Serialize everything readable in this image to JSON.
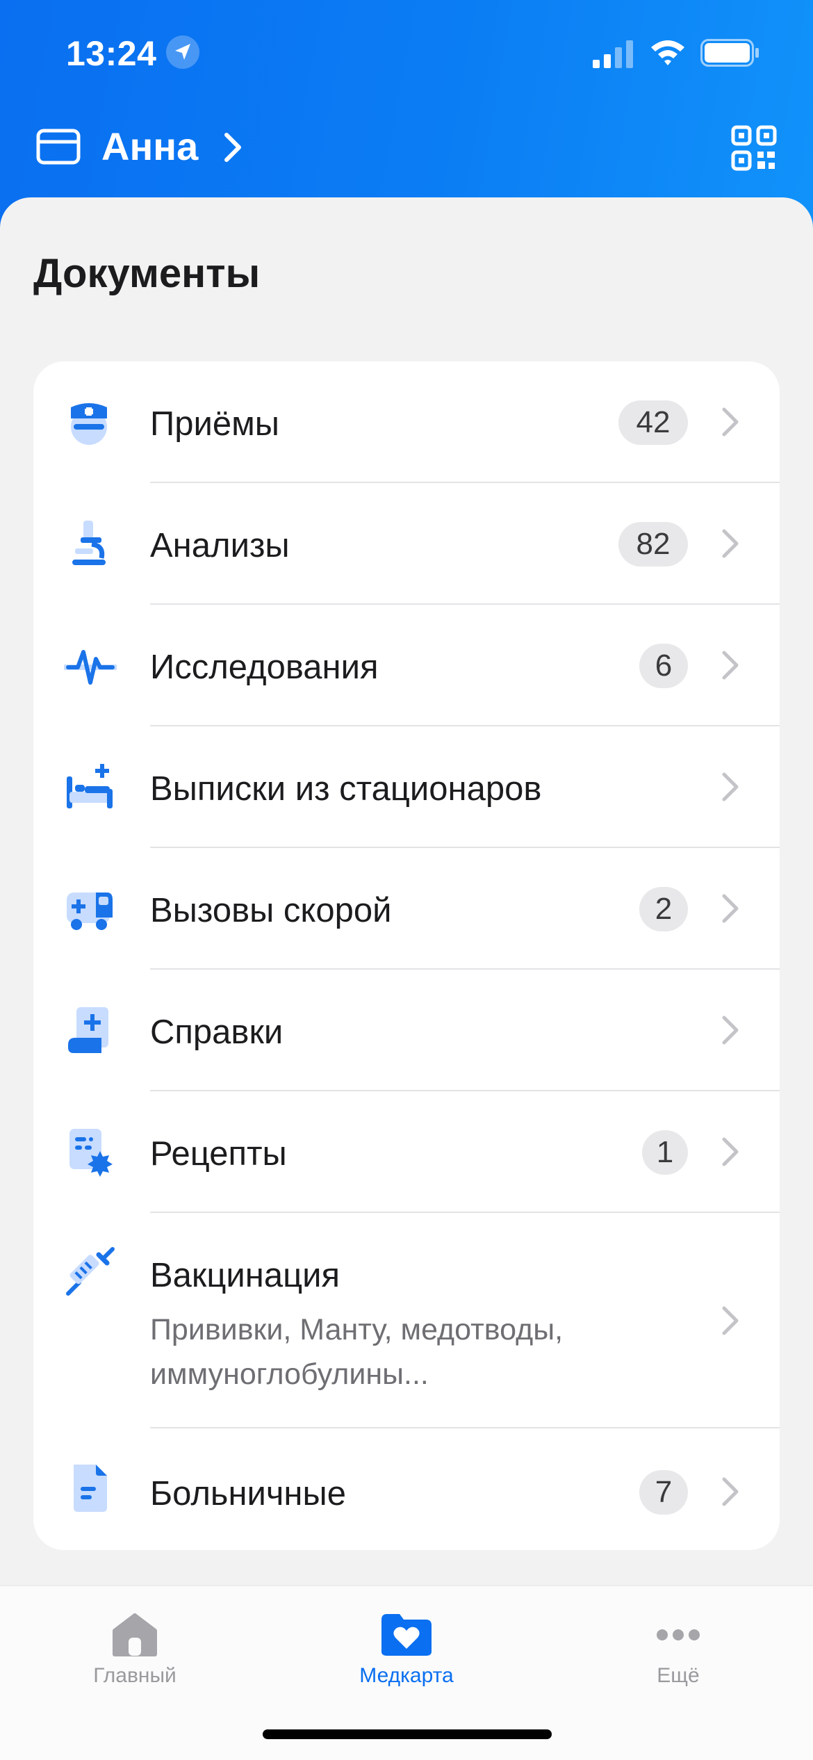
{
  "status_bar": {
    "time": "13:24"
  },
  "header": {
    "user_name": "Анна"
  },
  "section": {
    "title": "Документы"
  },
  "items": [
    {
      "label": "Приёмы",
      "badge": "42",
      "icon": "doctor-icon"
    },
    {
      "label": "Анализы",
      "badge": "82",
      "icon": "microscope-icon"
    },
    {
      "label": "Исследования",
      "badge": "6",
      "icon": "pulse-icon"
    },
    {
      "label": "Выписки из стационаров",
      "badge": "",
      "icon": "hospital-bed-icon"
    },
    {
      "label": "Вызовы скорой",
      "badge": "2",
      "icon": "ambulance-icon"
    },
    {
      "label": "Справки",
      "badge": "",
      "icon": "certificate-icon"
    },
    {
      "label": "Рецепты",
      "badge": "1",
      "icon": "prescription-icon"
    },
    {
      "label": "Вакцинация",
      "sublabel_line1": "Прививки, Манту, медотводы,",
      "sublabel_line2": "иммуноглобулины...",
      "badge": "",
      "icon": "syringe-icon"
    },
    {
      "label": "Больничные",
      "badge": "7",
      "icon": "sick-leave-doc-icon"
    }
  ],
  "tabbar": {
    "tabs": [
      {
        "label": "Главный",
        "icon": "home-icon",
        "active": false
      },
      {
        "label": "Медкарта",
        "icon": "medcard-folder-icon",
        "active": true
      },
      {
        "label": "Ещё",
        "icon": "more-icon",
        "active": false
      }
    ]
  },
  "colors": {
    "accent": "#0a6ff0",
    "icon_blue": "#1a73e8",
    "icon_light": "#c7dcff",
    "inactive": "#9a9a9e"
  }
}
